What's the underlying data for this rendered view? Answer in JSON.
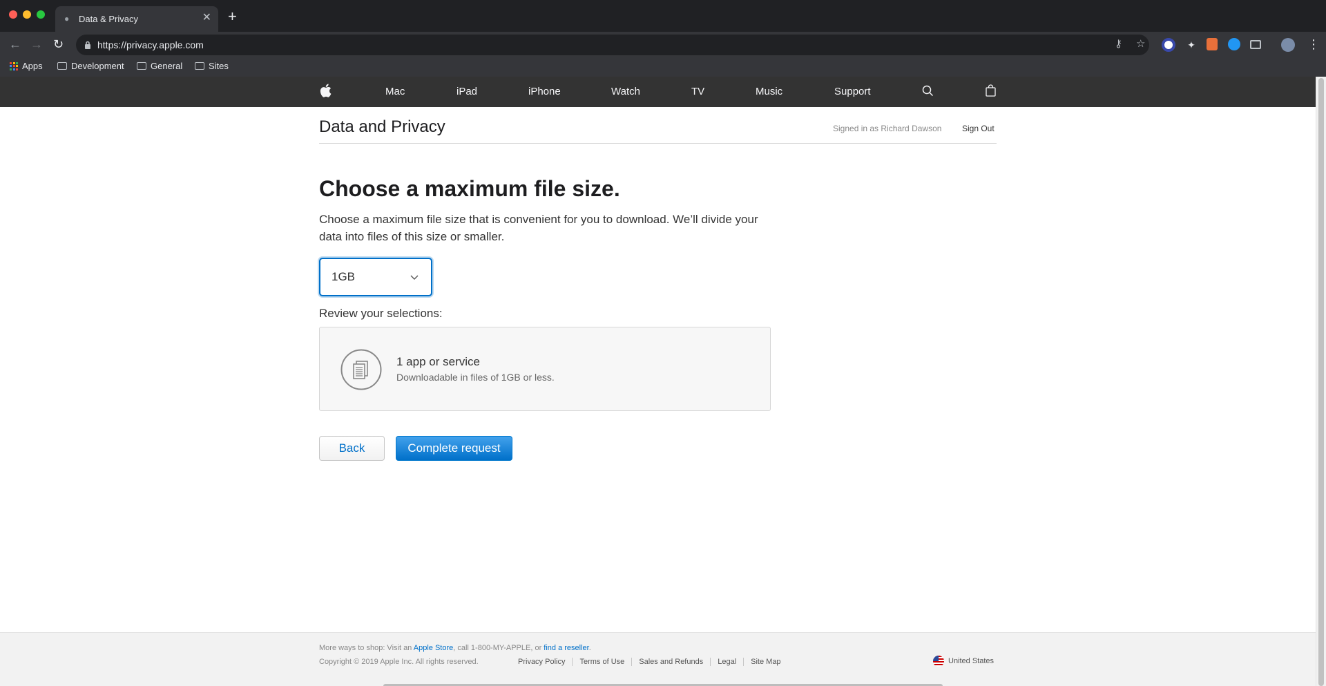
{
  "browser": {
    "tab_title": "Data & Privacy",
    "url": "https://privacy.apple.com",
    "bookmarks": [
      "Apps",
      "Development",
      "General",
      "Sites"
    ]
  },
  "globalnav": {
    "items": [
      "Mac",
      "iPad",
      "iPhone",
      "Watch",
      "TV",
      "Music",
      "Support"
    ]
  },
  "header": {
    "title": "Data and Privacy",
    "signed_in": "Signed in as Richard Dawson",
    "sign_out": "Sign Out"
  },
  "main": {
    "heading": "Choose a maximum file size.",
    "description": "Choose a maximum file size that is convenient for you to download. We’ll divide your data into files of this size or smaller.",
    "file_size_selected": "1GB",
    "review_label": "Review your selections:",
    "card_title": "1 app or service",
    "card_subtitle": "Downloadable in files of 1GB or less.",
    "back_label": "Back",
    "complete_label": "Complete request"
  },
  "footer": {
    "shop_prefix": "More ways to shop: Visit an",
    "apple_store": "Apple Store",
    "shop_middle": ", call 1-800-MY-APPLE, or",
    "reseller": "find a reseller",
    "shop_suffix": ".",
    "copyright": "Copyright © 2019 Apple Inc. All rights reserved.",
    "links": [
      "Privacy Policy",
      "Terms of Use",
      "Sales and Refunds",
      "Legal",
      "Site Map"
    ],
    "country": "United States"
  },
  "colors": {
    "accent": "#0070c9",
    "nav_bg": "#333333",
    "chrome_bg": "#202124"
  }
}
